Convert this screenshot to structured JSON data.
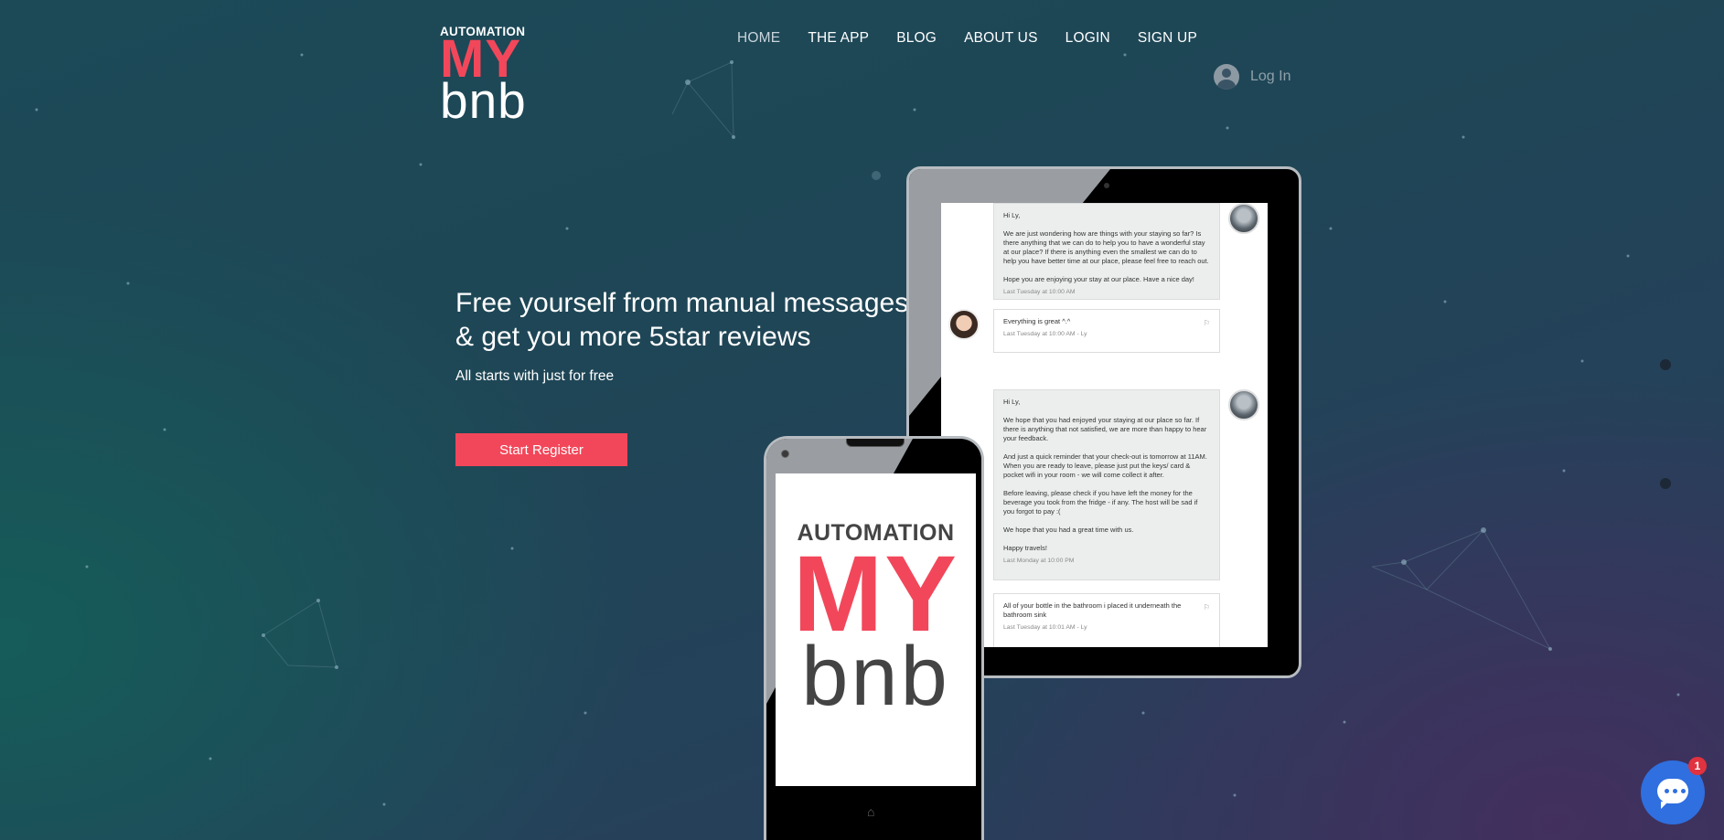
{
  "logo": {
    "line1": "AUTOMATION",
    "line2": "MY",
    "line3": "bnb"
  },
  "nav": {
    "items": [
      {
        "label": "HOME",
        "active": true
      },
      {
        "label": "THE APP"
      },
      {
        "label": "BLOG"
      },
      {
        "label": "ABOUT US"
      },
      {
        "label": "LOGIN"
      },
      {
        "label": "SIGN UP"
      }
    ]
  },
  "header": {
    "login_label": "Log In",
    "login_icon": "user-avatar-icon"
  },
  "hero": {
    "headline_line1": "Free yourself from manual messages",
    "headline_line2": "& get you more 5star reviews",
    "subline": "All starts with just for free",
    "cta_label": "Start Register"
  },
  "tablet": {
    "messages": [
      {
        "sender": "host",
        "paragraphs": [
          "Hi Ly,",
          "We are just wondering how are things with your staying so far? Is there anything that we can do to help you to have a wonderful stay at our place? If there is anything even the smallest we can do to help you have better time at our place, please feel free to reach out.",
          "Hope you are enjoying your stay at our place. Have a nice day!"
        ],
        "time": "Last Tuesday at 10:00 AM"
      },
      {
        "sender": "guest",
        "paragraphs": [
          "Everything is great ^.^"
        ],
        "time": "Last Tuesday at 10:00 AM - Ly"
      },
      {
        "sender": "host",
        "paragraphs": [
          "Hi Ly,",
          "We hope that you had enjoyed your staying at our place so far. If there is anything that not satisfied, we are more than happy to hear your feedback.",
          "And just a quick reminder that your check-out is tomorrow at 11AM. When you are ready to leave, please just put the keys/ card & pocket wifi in your room - we will come collect it after.",
          "Before leaving, please check if you have left the money for the beverage you took from the fridge - if any. The host will be sad if you forgot to pay :(",
          "We hope that you had a great time with us.",
          "Happy travels!"
        ],
        "time": "Last Monday at 10:00 PM"
      },
      {
        "sender": "guest",
        "paragraphs": [
          "All of your bottle in the bathroom i placed it underneath the bathroom sink"
        ],
        "time": "Last Tuesday at 10:01 AM - Ly"
      }
    ]
  },
  "phone": {
    "line1": "AUTOMATION",
    "line2": "MY",
    "line3": "bnb",
    "home_icon": "⌂"
  },
  "chat": {
    "badge_count": "1",
    "icon": "chat-bubble-icon"
  },
  "colors": {
    "accent": "#f2475a",
    "chat": "#2f6fe0"
  }
}
